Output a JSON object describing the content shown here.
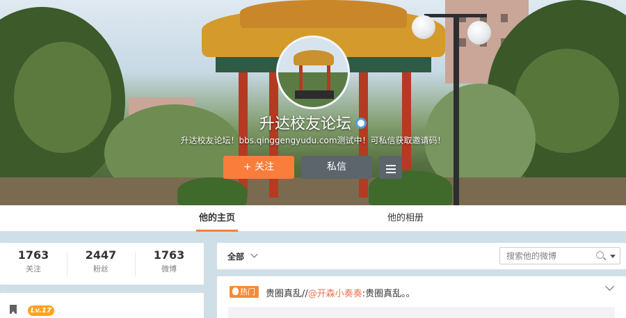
{
  "profile": {
    "name": "升达校友论坛",
    "description": "升达校友论坛！bbs.qinggengyudu.com测试中！可私信获取邀请码！",
    "follow_label": "+ 关注",
    "message_label": "私信"
  },
  "tabs": [
    {
      "label": "他的主页",
      "active": true
    },
    {
      "label": "他的相册",
      "active": false
    }
  ],
  "stats": [
    {
      "value": "1763",
      "label": "关注"
    },
    {
      "value": "2447",
      "label": "粉丝"
    },
    {
      "value": "1763",
      "label": "微博"
    }
  ],
  "level": {
    "badge": "Lv.17"
  },
  "feed": {
    "filter_label": "全部",
    "search_placeholder": "搜索他的微博"
  },
  "post": {
    "badge": "热门",
    "text_before": "贵圈真乱//",
    "mention": "@开森小奏奏",
    "text_after": ":贵圈真乱。。"
  },
  "colors": {
    "accent": "#fa7d3c",
    "dark_button": "#5c646c",
    "mention": "#eb7350",
    "level_badge": "#ffa31a",
    "verified": "#4d9ee0"
  },
  "icons": [
    "verified-icon",
    "menu-icon",
    "chevron-down-icon",
    "search-icon",
    "dropdown-caret-icon",
    "bookmark-icon",
    "flame-icon",
    "collapse-chevron-icon"
  ]
}
